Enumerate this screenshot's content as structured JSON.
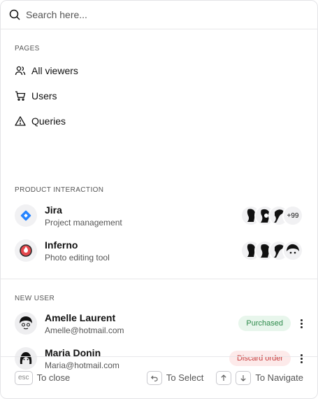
{
  "search": {
    "placeholder": "Search here..."
  },
  "pages": {
    "title": "PAGES",
    "items": [
      {
        "label": "All viewers",
        "icon": "users-icon"
      },
      {
        "label": "Users",
        "icon": "cart-icon"
      },
      {
        "label": "Queries",
        "icon": "warning-icon"
      }
    ]
  },
  "product_interaction": {
    "title": "PRODUCT INTERACTION",
    "items": [
      {
        "title": "Jira",
        "subtitle": "Project management",
        "icon": "jira-logo-icon",
        "extra_count": "+99"
      },
      {
        "title": "Inferno",
        "subtitle": "Photo editing tool",
        "icon": "inferno-logo-icon"
      }
    ]
  },
  "new_user": {
    "title": "NEW USER",
    "users": [
      {
        "name": "Amelle Laurent",
        "email": "Amelle@hotmail.com",
        "status": "Purchased",
        "status_color": "#2d8a4a"
      },
      {
        "name": "Maria Donin",
        "email": "Maria@hotmail.com",
        "status": "Discard order",
        "status_color": "#c43a3a"
      }
    ]
  },
  "footer": {
    "esc_key": "esc",
    "close_label": "To close",
    "select_label": "To Select",
    "navigate_label": "To Navigate"
  },
  "colors": {
    "jira_blue": "#2684ff",
    "inferno_red": "#e5484d",
    "border": "#e7e7ea"
  }
}
